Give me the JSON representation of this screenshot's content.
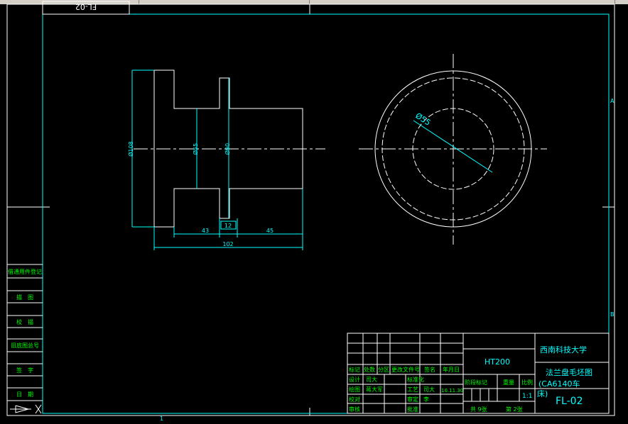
{
  "drawing": {
    "number": "FL-02",
    "number_mirrored": "FL-02",
    "material": "HT200",
    "school": "西南科技大学",
    "title_line1": "法兰盘毛坯图",
    "title_line2": "(CA6140车",
    "title_line3": "床)",
    "scale_label": "比例",
    "scale_value": "1:1",
    "weight_label": "重量",
    "stage_label": "阶段标记",
    "total_sheets": "共 9张",
    "sheet_no": "第 2张"
  },
  "dimensions": {
    "d108": "Ø108",
    "d55_left": "Ø55",
    "d90": "Ø90",
    "len43": "43",
    "len12": "12",
    "len45": "45",
    "len102": "102",
    "d55_right": "Ø55"
  },
  "side_table": [
    "借通用件登记",
    "描　图",
    "校　描",
    "旧底图总号",
    "签　字",
    "日　期"
  ],
  "zones": {
    "a": "A",
    "b": "B",
    "one": "1"
  },
  "title_block": {
    "h_biaoji": "标记",
    "h_chushu": "处数",
    "h_fenqu": "分区",
    "h_gengai": "更改文件号",
    "h_qianming": "签名",
    "h_riqi": "年月日",
    "r_sheji": "设计",
    "r_sheji_name": "司大",
    "r_biaozhunhua": "标准化",
    "r_huitu": "绘图",
    "r_huitu_name": "蒋大军",
    "r_gongyi": "工艺",
    "r_gongyi_name": "司大",
    "r_date": "10.11.30",
    "r_jiaodui": "校对",
    "r_shending": "审定",
    "r_shending_name": "李",
    "r_shenhe": "审核",
    "r_pizhun": "批准"
  },
  "colors": {
    "frame": "#ffffff",
    "dimension": "#00ffff",
    "text": "#00ff00",
    "background": "#000000"
  }
}
